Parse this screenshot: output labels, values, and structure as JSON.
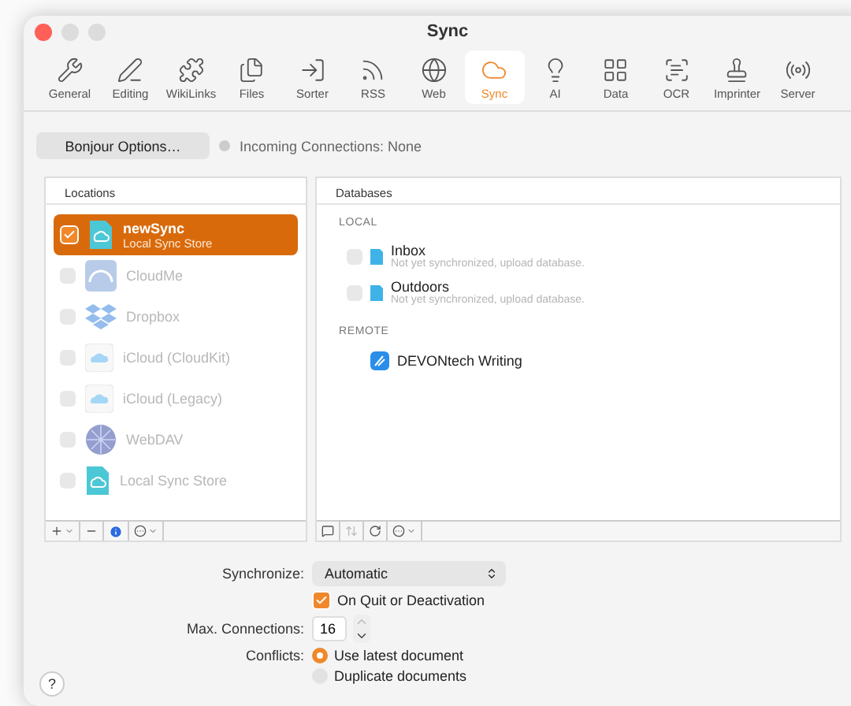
{
  "window": {
    "title": "Sync"
  },
  "tabs": [
    {
      "label": "General",
      "selected": false
    },
    {
      "label": "Editing",
      "selected": false
    },
    {
      "label": "WikiLinks",
      "selected": false
    },
    {
      "label": "Files",
      "selected": false
    },
    {
      "label": "Sorter",
      "selected": false
    },
    {
      "label": "RSS",
      "selected": false
    },
    {
      "label": "Web",
      "selected": false
    },
    {
      "label": "Sync",
      "selected": true
    },
    {
      "label": "AI",
      "selected": false
    },
    {
      "label": "Data",
      "selected": false
    },
    {
      "label": "OCR",
      "selected": false
    },
    {
      "label": "Imprinter",
      "selected": false
    },
    {
      "label": "Server",
      "selected": false
    }
  ],
  "bonjour_button": "Bonjour Options…",
  "incoming_connections": "Incoming Connections: None",
  "locations": {
    "header": "Locations",
    "items": [
      {
        "kind": "store",
        "name": "newSync",
        "subtitle": "Local Sync Store",
        "checked": true,
        "selected": true,
        "disabled": false
      },
      {
        "kind": "cloudme",
        "name": "CloudMe",
        "checked": false,
        "selected": false,
        "disabled": true
      },
      {
        "kind": "dropbox",
        "name": "Dropbox",
        "checked": false,
        "selected": false,
        "disabled": true
      },
      {
        "kind": "icloud",
        "name": "iCloud (CloudKit)",
        "checked": false,
        "selected": false,
        "disabled": true
      },
      {
        "kind": "icloud",
        "name": "iCloud (Legacy)",
        "checked": false,
        "selected": false,
        "disabled": true
      },
      {
        "kind": "webdav",
        "name": "WebDAV",
        "checked": false,
        "selected": false,
        "disabled": true
      },
      {
        "kind": "store",
        "name": "Local Sync Store",
        "checked": false,
        "selected": false,
        "disabled": true
      }
    ]
  },
  "databases": {
    "header": "Databases",
    "sections": [
      {
        "title": "LOCAL",
        "items": [
          {
            "kind": "local",
            "name": "Inbox",
            "status": "Not yet synchronized, upload database.",
            "checked": false
          },
          {
            "kind": "local",
            "name": "Outdoors",
            "status": "Not yet synchronized, upload database.",
            "checked": false
          }
        ]
      },
      {
        "title": "REMOTE",
        "items": [
          {
            "kind": "remote",
            "name": "DEVONtech Writing"
          }
        ]
      }
    ]
  },
  "form": {
    "synchronize_label": "Synchronize:",
    "synchronize_value": "Automatic",
    "on_quit": {
      "label": "On Quit or Deactivation",
      "checked": true
    },
    "max_connections_label": "Max. Connections:",
    "max_connections_value": "16",
    "conflicts_label": "Conflicts:",
    "conflict_options": [
      {
        "label": "Use latest document",
        "selected": true
      },
      {
        "label": "Duplicate documents",
        "selected": false
      }
    ]
  },
  "help": "?"
}
